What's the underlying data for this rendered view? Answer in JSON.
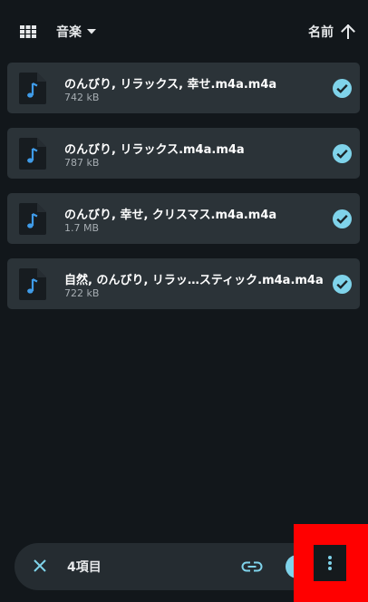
{
  "toolbar": {
    "grid_icon": "grid-view-icon",
    "filter_label": "音楽",
    "filter_icon": "dropdown-arrow-icon",
    "sort_label": "名前",
    "sort_icon": "arrow-up-icon"
  },
  "files": [
    {
      "name": "のんびり, リラックス, 幸せ.m4a.m4a",
      "size": "742 kB",
      "selected": true
    },
    {
      "name": "のんびり, リラックス.m4a.m4a",
      "size": "787 kB",
      "selected": true
    },
    {
      "name": "のんびり, 幸せ, クリスマス.m4a.m4a",
      "size": "1.7 MB",
      "selected": true
    },
    {
      "name": "自然, のんびり, リラッ…スティック.m4a.m4a",
      "size": "722 kB",
      "selected": true
    }
  ],
  "selection_bar": {
    "count_label": "4項目",
    "close_icon": "close-icon",
    "link_icon": "link-icon",
    "more_icon": "more-vert-icon"
  },
  "colors": {
    "background": "#12171b",
    "card": "#2b3338",
    "accent": "#7fd3ea",
    "music_note": "#3f9be8",
    "highlight": "#ff0000"
  }
}
